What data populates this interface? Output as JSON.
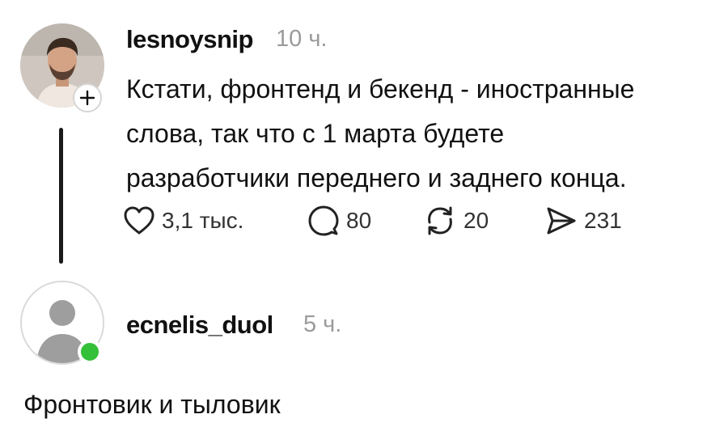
{
  "post": {
    "username": "lesnoysnip",
    "time": "10 ч.",
    "text": "Кстати, фронтенд и бекенд - иностранные\nслова, так что с 1 марта будете\nразработчики переднего и заднего конца.",
    "actions": {
      "likes": "3,1 тыс.",
      "replies": "80",
      "reposts": "20",
      "shares": "231"
    },
    "icons": {
      "like": "heart-icon",
      "reply": "speech-bubble-icon",
      "repost": "repost-arrows-icon",
      "share": "paper-plane-icon",
      "follow": "plus-icon"
    }
  },
  "reply": {
    "username": "ecnelis_duol",
    "time": "5 ч.",
    "text": "Фронтовик и тыловик",
    "status_color": "#34c038"
  }
}
